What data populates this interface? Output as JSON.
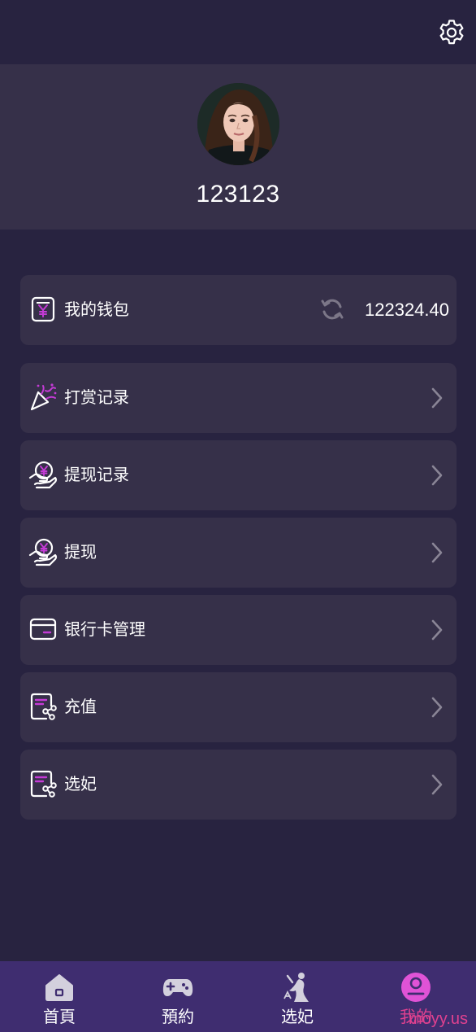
{
  "header": {
    "settings_icon": "gear-icon"
  },
  "profile": {
    "username": "123123",
    "avatar_icon": "user-photo"
  },
  "wallet": {
    "label": "我的钱包",
    "balance": "122324.40",
    "icon": "wallet-yen-icon",
    "refresh_icon": "refresh-icon"
  },
  "menu": {
    "items": [
      {
        "label": "打赏记录",
        "icon": "party-popper-icon"
      },
      {
        "label": "提现记录",
        "icon": "yen-hand-icon"
      },
      {
        "label": "提现",
        "icon": "yen-hand-icon"
      },
      {
        "label": "银行卡管理",
        "icon": "bank-card-icon"
      },
      {
        "label": "充值",
        "icon": "document-share-icon"
      },
      {
        "label": "选妃",
        "icon": "document-share-icon"
      }
    ]
  },
  "tabbar": {
    "tabs": [
      {
        "label": "首頁",
        "icon": "home-icon"
      },
      {
        "label": "預約",
        "icon": "gamepad-icon"
      },
      {
        "label": "选妃",
        "icon": "dancer-icon"
      },
      {
        "label": "我的",
        "icon": "user-circle-icon",
        "active": true
      }
    ]
  },
  "watermark": "moyy.us",
  "colors": {
    "background": "#282340",
    "card": "#363049",
    "accent": "#e0418f",
    "icon_accent": "#c43bd6",
    "tabbar": "#3f2d70"
  }
}
